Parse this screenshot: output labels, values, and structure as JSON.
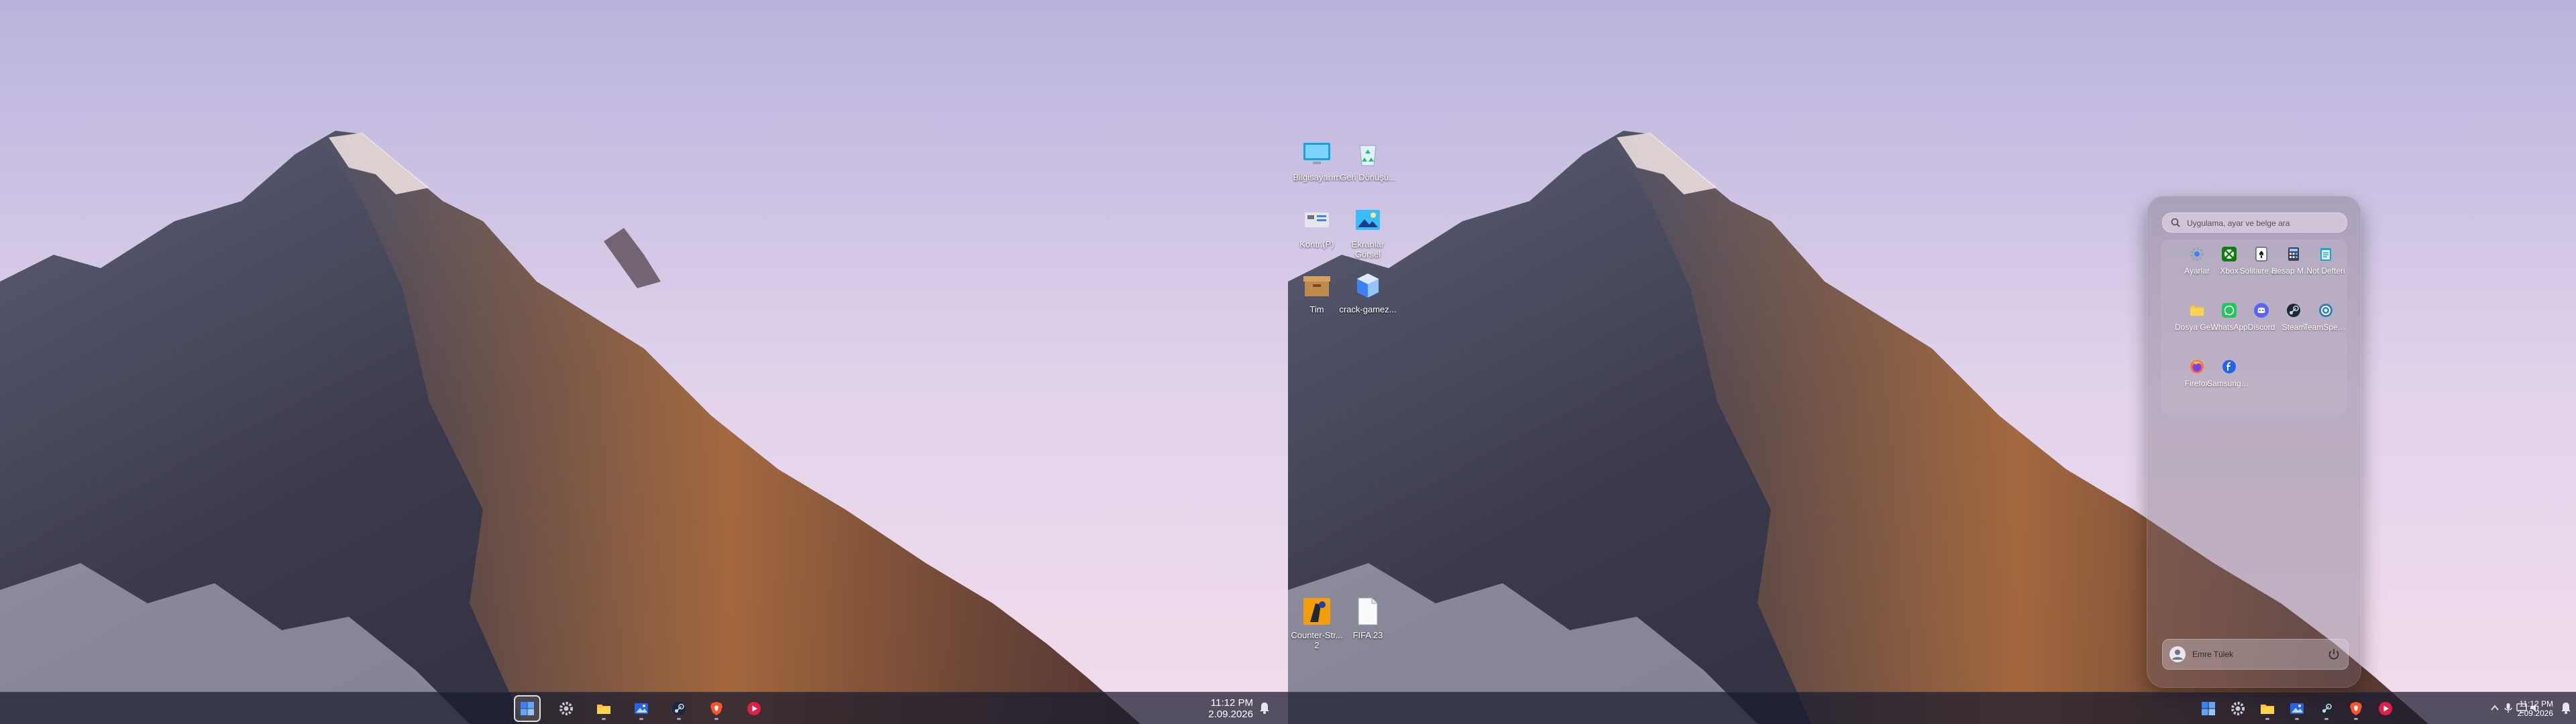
{
  "left_monitor": {
    "taskbar": {
      "apps": [
        {
          "name": "start-button",
          "icon": "windows-logo-icon"
        },
        {
          "name": "settings",
          "icon": "gear-icon"
        },
        {
          "name": "file-explorer",
          "icon": "folder-icon"
        },
        {
          "name": "photos",
          "icon": "photos-icon"
        },
        {
          "name": "steam",
          "icon": "steam-icon"
        },
        {
          "name": "brave",
          "icon": "brave-icon"
        },
        {
          "name": "media-player",
          "icon": "media-player-icon"
        }
      ],
      "clock": {
        "time": "11:12 PM",
        "date": "2.09.2026"
      }
    }
  },
  "right_monitor": {
    "desktop_icons": [
      {
        "label": "Bilgisayarım",
        "icon": "monitor-icon"
      },
      {
        "label": "Geri Dönüşü...",
        "icon": "recycle-bin-icon"
      },
      {
        "label": "Kontr.(P)",
        "icon": "control-panel-icon"
      },
      {
        "label": "Ekranlar Görsel",
        "icon": "picture-icon"
      },
      {
        "label": "Tim",
        "icon": "archive-box-icon"
      },
      {
        "label": "crack-gamez...",
        "icon": "cube-icon"
      },
      {
        "label": "Counter-Str... 2",
        "icon": "game-icon"
      },
      {
        "label": "FIFA 23",
        "icon": "document-icon"
      }
    ],
    "start_menu": {
      "search_placeholder": "Uygulama, ayar ve belge ara",
      "apps": [
        {
          "label": "Ayarlar",
          "icon": "gear-icon"
        },
        {
          "label": "Xbox",
          "icon": "xbox-icon"
        },
        {
          "label": "Solitaire &...",
          "icon": "solitaire-icon"
        },
        {
          "label": "Hesap Makinesi",
          "icon": "calculator-icon"
        },
        {
          "label": "Not Defteri",
          "icon": "notepad-icon"
        },
        {
          "label": "Dosya Gezgini",
          "icon": "folder-icon"
        },
        {
          "label": "WhatsApp",
          "icon": "whatsapp-icon"
        },
        {
          "label": "Discord",
          "icon": "discord-icon"
        },
        {
          "label": "Steam",
          "icon": "steam-icon"
        },
        {
          "label": "TeamSpeak 3...",
          "icon": "teamspeak-icon"
        },
        {
          "label": "Firefox",
          "icon": "firefox-icon"
        },
        {
          "label": "Samsung Flow",
          "icon": "samsung-flow-icon"
        }
      ],
      "user_name": "Emre Tülek"
    },
    "taskbar": {
      "apps": [
        {
          "name": "start-button",
          "icon": "windows-logo-icon"
        },
        {
          "name": "settings",
          "icon": "gear-icon"
        },
        {
          "name": "file-explorer",
          "icon": "folder-icon"
        },
        {
          "name": "photos",
          "icon": "photos-icon"
        },
        {
          "name": "steam",
          "icon": "steam-icon"
        },
        {
          "name": "brave",
          "icon": "brave-icon"
        },
        {
          "name": "media-player",
          "icon": "media-player-icon"
        }
      ],
      "tray_icons": [
        "chevron-up-icon",
        "microphone-icon",
        "network-icon",
        "volume-icon",
        "battery-icon"
      ],
      "clock": {
        "time": "11:12 PM",
        "date": "2.09.2026"
      }
    }
  },
  "colors": {
    "taskbar": "#181b2e",
    "accent": "#3b82f6",
    "sky_top": "#b9b2dc",
    "sky_bottom": "#f1dcea"
  }
}
